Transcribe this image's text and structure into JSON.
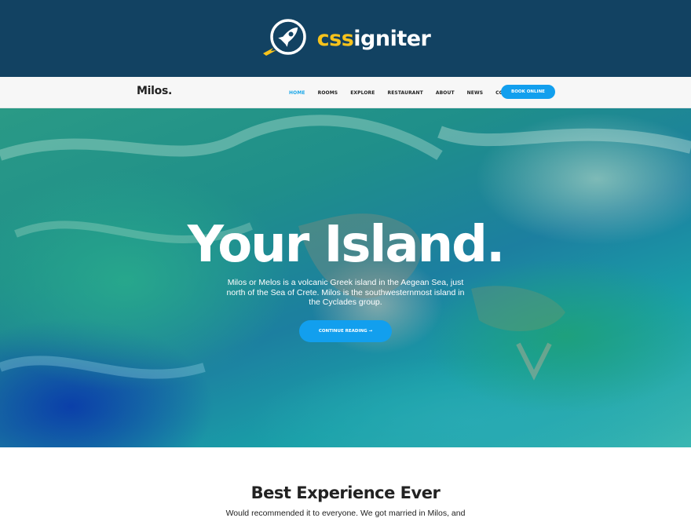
{
  "brand": {
    "name_part_a": "css",
    "name_part_b": "igniter",
    "logo_icon": "rocket-icon",
    "colors": {
      "background": "#124262",
      "accent": "#f7c31c"
    }
  },
  "site": {
    "logo": "Milos.",
    "nav": {
      "items": [
        {
          "label": "HOME",
          "active": true
        },
        {
          "label": "ROOMS",
          "active": false
        },
        {
          "label": "EXPLORE",
          "active": false
        },
        {
          "label": "RESTAURANT",
          "active": false
        },
        {
          "label": "ABOUT",
          "active": false
        },
        {
          "label": "NEWS",
          "active": false
        },
        {
          "label": "CONTACT",
          "active": false
        }
      ],
      "cta_label": "BOOK ONLINE"
    },
    "colors": {
      "accent": "#129fee",
      "active_nav": "#1ea8e8"
    }
  },
  "hero": {
    "title": "Your Island.",
    "description": "Milos or Melos is a volcanic Greek island in the Aegean Sea, just north of the Sea of Crete. Milos is the southwesternmost island in the Cyclades group.",
    "button_label": "CONTINUE READING →"
  },
  "testimonial": {
    "title": "Best Experience Ever",
    "text": "Would recommended it to everyone. We got married in Milos, and"
  }
}
